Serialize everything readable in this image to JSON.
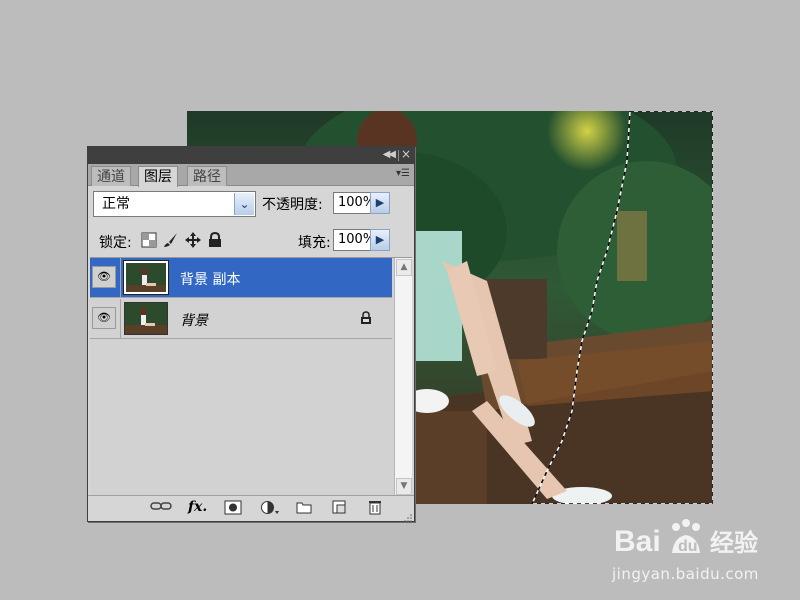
{
  "panel": {
    "tabs": [
      {
        "label": "通道",
        "active": false
      },
      {
        "label": "图层",
        "active": true
      },
      {
        "label": "路径",
        "active": false
      }
    ],
    "blend_mode": "正常",
    "opacity_label": "不透明度:",
    "opacity_value": "100%",
    "lock_label": "锁定:",
    "fill_label": "填充:",
    "fill_value": "100%",
    "layers": [
      {
        "name": "背景 副本",
        "selected": true,
        "visible": true,
        "locked": false
      },
      {
        "name": "背景",
        "selected": false,
        "visible": true,
        "locked": true
      }
    ],
    "bottom_icons": [
      "link-icon",
      "fx-icon",
      "mask-icon",
      "adjustment-icon",
      "folder-icon",
      "new-layer-icon",
      "trash-icon"
    ]
  },
  "colors": {
    "selection": "#3268c3",
    "panel_bg": "#d6d6d6",
    "workspace_bg": "#bcbcbc"
  },
  "watermark": {
    "logo": "Bai du 经验",
    "url": "jingyan.baidu.com"
  }
}
